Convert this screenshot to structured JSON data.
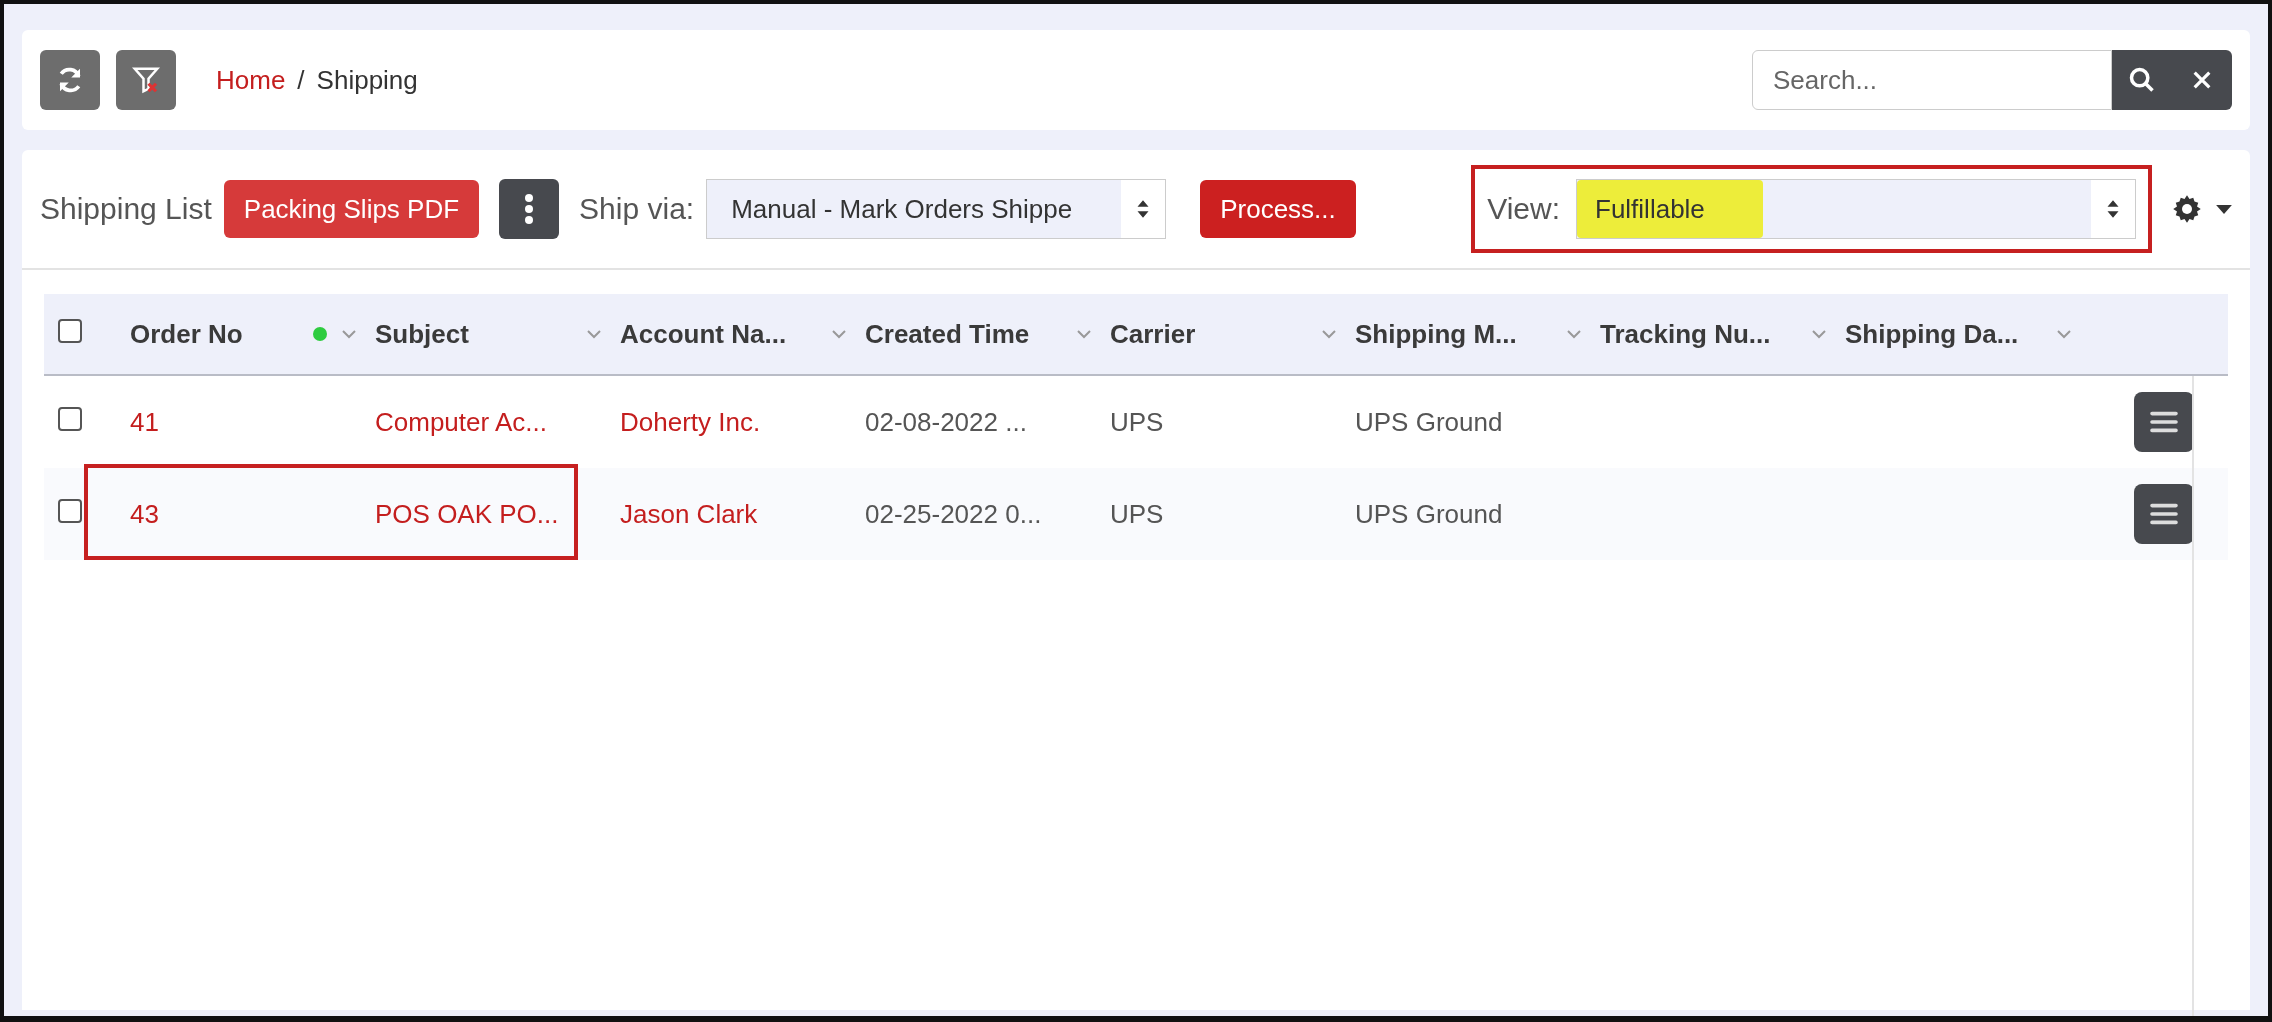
{
  "breadcrumb": {
    "home": "Home",
    "separator": "/",
    "current": "Shipping"
  },
  "search": {
    "placeholder": "Search..."
  },
  "toolbar": {
    "title": "Shipping List",
    "pdf_button": "Packing Slips PDF",
    "ship_via_label": "Ship via:",
    "ship_via_value": "Manual - Mark Orders Shippe",
    "process_button": "Process...",
    "view_label": "View:",
    "view_value": "Fulfillable",
    "view_highlighted": true,
    "view_framed": true
  },
  "table": {
    "header_checked": false,
    "columns": [
      {
        "label": "Order No",
        "color": "#2ecc40"
      },
      {
        "label": "Subject"
      },
      {
        "label": "Account Na..."
      },
      {
        "label": "Created Time"
      },
      {
        "label": "Carrier"
      },
      {
        "label": "Shipping M..."
      },
      {
        "label": "Tracking Nu..."
      },
      {
        "label": "Shipping Da..."
      }
    ],
    "rows": [
      {
        "checked": false,
        "framed": false,
        "cells": [
          {
            "text": "41",
            "kind": "link"
          },
          {
            "text": "Computer Ac...",
            "kind": "link"
          },
          {
            "text": "Doherty Inc.",
            "kind": "link"
          },
          {
            "text": "02-08-2022 ...",
            "kind": "plain"
          },
          {
            "text": "UPS",
            "kind": "plain"
          },
          {
            "text": "UPS Ground",
            "kind": "plain"
          }
        ]
      },
      {
        "checked": false,
        "framed": true,
        "cells": [
          {
            "text": "43",
            "kind": "link"
          },
          {
            "text": "POS OAK PO...",
            "kind": "link"
          },
          {
            "text": "Jason Clark",
            "kind": "link"
          },
          {
            "text": "02-25-2022 0...",
            "kind": "plain"
          },
          {
            "text": "UPS",
            "kind": "plain"
          },
          {
            "text": "UPS Ground",
            "kind": "plain"
          }
        ]
      }
    ]
  }
}
